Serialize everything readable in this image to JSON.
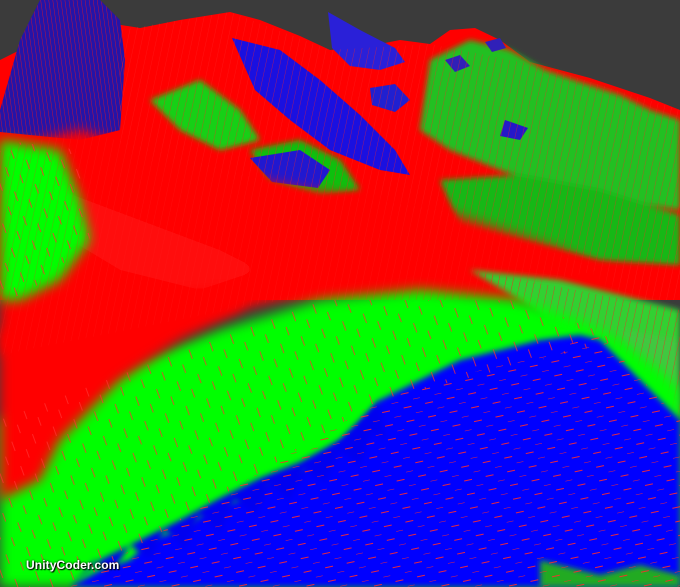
{
  "scene": {
    "description_colors": {
      "background": "#3b3b3b",
      "high_slope": "#ff0000",
      "mid_slope": "#00ff00",
      "low_slope": "#0000ff",
      "normal_lines": "#ff2a2a"
    }
  },
  "watermark": {
    "text": "UnityCoder.com"
  }
}
